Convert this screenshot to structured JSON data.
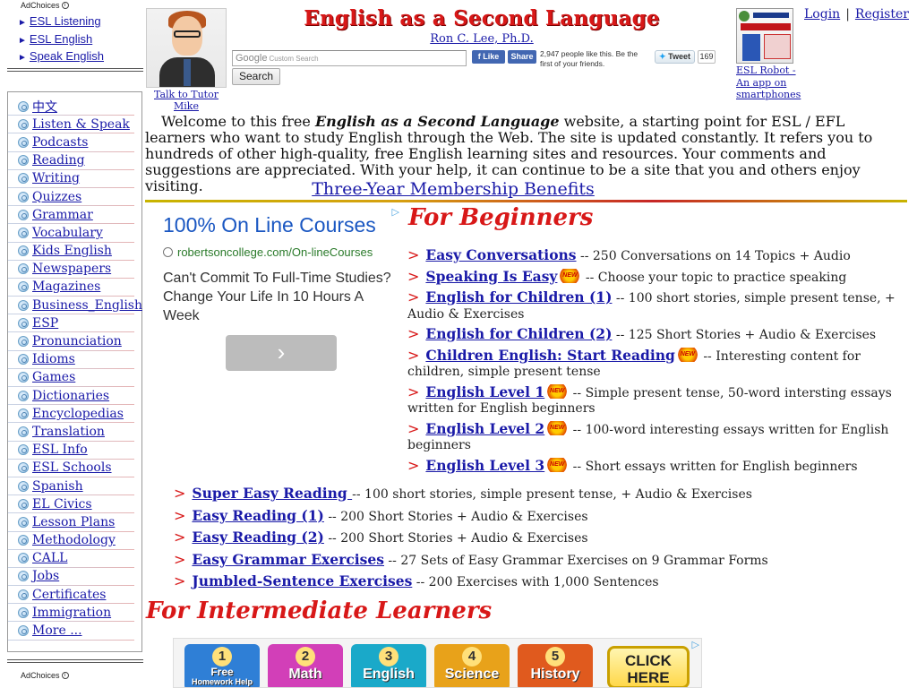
{
  "left_ad": {
    "adchoices_label": "AdChoices",
    "links": [
      "ESL Listening",
      "ESL English",
      "Speak English"
    ]
  },
  "nav": {
    "items": [
      "中文",
      "Listen & Speak",
      "Podcasts",
      "Reading",
      "Writing",
      "Quizzes",
      "Grammar",
      "Vocabulary",
      "Kids English",
      "Newspapers",
      "Magazines",
      "Business_English",
      "ESP",
      "Pronunciation",
      "Idioms",
      "Games",
      "Dictionaries",
      "Encyclopedias",
      "Translation",
      "ESL Info",
      "ESL Schools",
      "Spanish",
      "EL Civics",
      "Lesson Plans",
      "Methodology",
      "CALL",
      "Jobs",
      "Certificates",
      "Immigration",
      "More ..."
    ]
  },
  "left_bottom": {
    "adchoices_label": "AdChoices"
  },
  "header": {
    "tutor_caption": "Talk to Tutor Mike",
    "title": "English as a Second Language",
    "author": "Ron C. Lee, Ph.D.",
    "search_logo": "Google",
    "search_placeholder": "Custom Search",
    "search_button": "Search",
    "fb_like": "Like",
    "fb_share": "Share",
    "fb_text": "2,947 people like this. Be the first of your friends.",
    "tweet_label": "Tweet",
    "tweet_count": "169",
    "robot_caption": "ESL Robot - An app on smartphones",
    "login": "Login",
    "register": "Register",
    "separator": "|"
  },
  "welcome": {
    "intro": "Welcome to this free ",
    "emphasis": "English as a Second Language",
    "rest": " website, a starting point for ESL / EFL learners who want to study English through the Web. The site is updated constantly. It refers you to hundreds of other high-quality, free English learning sites and resources. Your comments and suggestions are appreciated. With your help, it can continue to be a site that you and others enjoy visiting.",
    "benefits_link": "Three-Year Membership Benefits"
  },
  "ad_side": {
    "title": "100% On Line Courses",
    "url": "robertsoncollege.com/On-lineCourses",
    "description": "Can't Commit To Full-Time Studies? Change Your Life In 10 Hours A Week",
    "arrow": "›",
    "choices": "▷"
  },
  "beginners": {
    "heading": "For Beginners",
    "arrow": ">",
    "new_badge": "NEW",
    "items": [
      {
        "link": "Easy Conversations",
        "desc": " -- 250 Conversations on 14 Topics + Audio"
      },
      {
        "link": "Speaking Is Easy",
        "desc": " -- Choose your topic to practice speaking"
      },
      {
        "link": "English for Children (1)",
        "desc": " -- 100 short stories, simple present tense, + Audio & Exercises"
      },
      {
        "link": "English for Children (2)",
        "desc": " -- 125 Short Stories + Audio & Exercises"
      },
      {
        "link": "Children English: Start Reading",
        "desc": " -- Interesting content for children, simple present tense"
      },
      {
        "link": "English Level 1",
        "desc": " -- Simple present tense, 50-word intersting essays written for English beginners"
      },
      {
        "link": "English Level 2",
        "desc": " -- 100-word interesting essays written for English beginners"
      },
      {
        "link": "English Level 3",
        "desc": " -- Short essays written for English beginners"
      }
    ]
  },
  "more": {
    "items": [
      {
        "link": "Super Easy Reading ",
        "desc": " -- 100 short stories, simple present tense, + Audio & Exercises"
      },
      {
        "link": "Easy Reading (1)",
        "desc": " -- 200 Short Stories + Audio & Exercises"
      },
      {
        "link": "Easy Reading (2)",
        "desc": " -- 200 Short Stories + Audio & Exercises"
      },
      {
        "link": "Easy Grammar Exercises",
        "desc": " -- 27 Sets of Easy Grammar Exercises on 9 Grammar Forms"
      },
      {
        "link": "Jumbled-Sentence Exercises",
        "desc": " -- 200 Exercises with 1,000 Sentences"
      }
    ]
  },
  "intermediate": {
    "heading": "For Intermediate Learners"
  },
  "banner": {
    "tiles": [
      {
        "num": "1",
        "label": "Free",
        "sub": "Homework Help",
        "color": "#2f7fd6"
      },
      {
        "num": "2",
        "label": "Math",
        "color": "#d23fb8"
      },
      {
        "num": "3",
        "label": "English",
        "color": "#1aa9c9"
      },
      {
        "num": "4",
        "label": "Science",
        "color": "#e8a21a"
      },
      {
        "num": "5",
        "label": "History",
        "color": "#e05a1e"
      }
    ],
    "cta": "CLICK HERE",
    "choices": "▷"
  }
}
